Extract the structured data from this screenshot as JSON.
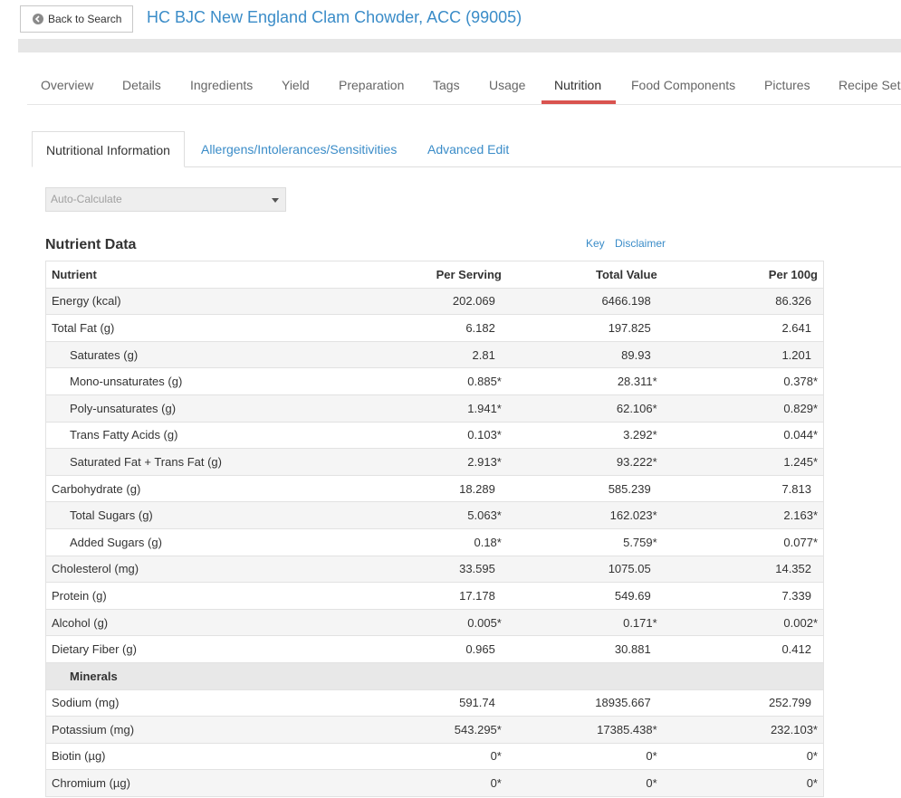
{
  "header": {
    "back_label": "Back to Search",
    "title": "HC BJC New England Clam Chowder, ACC (99005)"
  },
  "tabs": [
    "Overview",
    "Details",
    "Ingredients",
    "Yield",
    "Preparation",
    "Tags",
    "Usage",
    "Nutrition",
    "Food Components",
    "Pictures",
    "Recipe Set"
  ],
  "active_tab": "Nutrition",
  "subtabs": [
    "Nutritional Information",
    "Allergens/Intolerances/Sensitivities",
    "Advanced Edit"
  ],
  "active_subtab": "Nutritional Information",
  "calc_select": {
    "value": "Auto-Calculate"
  },
  "nutrient_data": {
    "title": "Nutrient Data",
    "key_link": "Key",
    "disclaimer_link": "Disclaimer",
    "columns": [
      "Nutrient",
      "Per Serving",
      "Total Value",
      "Per 100g"
    ],
    "rows": [
      {
        "name": "Energy (kcal)",
        "per_serving": "202.069",
        "total": "6466.198",
        "per100g": "86.326"
      },
      {
        "name": "Total Fat (g)",
        "per_serving": "6.182",
        "total": "197.825",
        "per100g": "2.641"
      },
      {
        "name": "Saturates (g)",
        "per_serving": "2.81",
        "total": "89.93",
        "per100g": "1.201",
        "indent": true
      },
      {
        "name": "Mono-unsaturates (g)",
        "per_serving": "0.885*",
        "total": "28.311*",
        "per100g": "0.378*",
        "indent": true
      },
      {
        "name": "Poly-unsaturates (g)",
        "per_serving": "1.941*",
        "total": "62.106*",
        "per100g": "0.829*",
        "indent": true
      },
      {
        "name": "Trans Fatty Acids (g)",
        "per_serving": "0.103*",
        "total": "3.292*",
        "per100g": "0.044*",
        "indent": true
      },
      {
        "name": "Saturated Fat + Trans Fat (g)",
        "per_serving": "2.913*",
        "total": "93.222*",
        "per100g": "1.245*",
        "indent": true
      },
      {
        "name": "Carbohydrate (g)",
        "per_serving": "18.289",
        "total": "585.239",
        "per100g": "7.813"
      },
      {
        "name": "Total Sugars (g)",
        "per_serving": "5.063*",
        "total": "162.023*",
        "per100g": "2.163*",
        "indent": true
      },
      {
        "name": "Added Sugars (g)",
        "per_serving": "0.18*",
        "total": "5.759*",
        "per100g": "0.077*",
        "indent": true
      },
      {
        "name": "Cholesterol (mg)",
        "per_serving": "33.595",
        "total": "1075.05",
        "per100g": "14.352"
      },
      {
        "name": "Protein (g)",
        "per_serving": "17.178",
        "total": "549.69",
        "per100g": "7.339"
      },
      {
        "name": "Alcohol (g)",
        "per_serving": "0.005*",
        "total": "0.171*",
        "per100g": "0.002*"
      },
      {
        "name": "Dietary Fiber (g)",
        "per_serving": "0.965",
        "total": "30.881",
        "per100g": "0.412"
      },
      {
        "name": "Minerals",
        "section": true
      },
      {
        "name": "Sodium (mg)",
        "per_serving": "591.74",
        "total": "18935.667",
        "per100g": "252.799"
      },
      {
        "name": "Potassium (mg)",
        "per_serving": "543.295*",
        "total": "17385.438*",
        "per100g": "232.103*"
      },
      {
        "name": "Biotin (µg)",
        "per_serving": "0*",
        "total": "0*",
        "per100g": "0*"
      },
      {
        "name": "Chromium (µg)",
        "per_serving": "0*",
        "total": "0*",
        "per100g": "0*"
      }
    ]
  }
}
